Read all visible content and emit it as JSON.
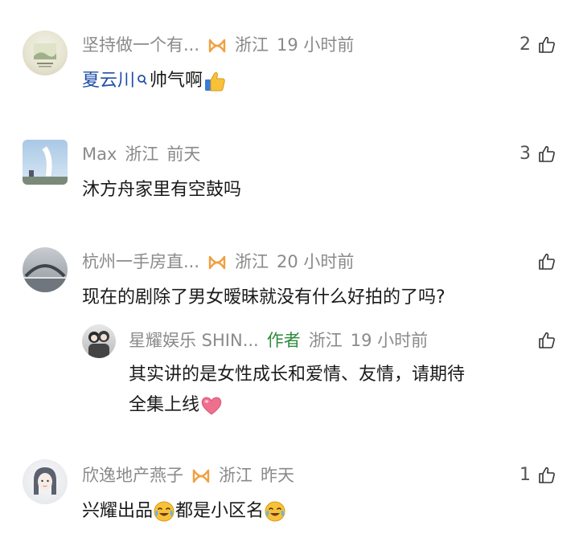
{
  "comments": [
    {
      "author": "坚持做一个有...",
      "location": "浙江",
      "time": "19 小时前",
      "likes": "2",
      "mention": "夏云川",
      "text": "帅气啊",
      "avatar_icon": "landscape-avatar",
      "emoji_icon": "thumbs-up-emoji"
    },
    {
      "author": "Max",
      "location": "浙江",
      "time": "前天",
      "likes": "3",
      "text": "沐方舟家里有空鼓吗",
      "avatar_icon": "sculpture-avatar"
    },
    {
      "author": "杭州一手房直...",
      "location": "浙江",
      "time": "20 小时前",
      "likes": "",
      "text": "现在的剧除了男女暧昧就没有什么好拍的了吗?",
      "avatar_icon": "bridge-avatar",
      "reply": {
        "author": "星耀娱乐 SHIN...",
        "tag": "作者",
        "location": "浙江",
        "time": "19 小时前",
        "likes": "",
        "text_line1": "其实讲的是女性成长和爱情、友情，请期待",
        "text_line2": "全集上线",
        "avatar_icon": "couple-avatar",
        "emoji_icon": "pink-heart-emoji"
      }
    },
    {
      "author": "欣逸地产燕子",
      "location": "浙江",
      "time": "昨天",
      "likes": "1",
      "text_part1": "兴耀出品",
      "text_part2": "都是小区名",
      "avatar_icon": "girl-avatar",
      "emoji_icon": "crying-laugh-emoji"
    }
  ],
  "colors": {
    "meta_gray": "#8a8a8a",
    "mention_blue": "#1f4fa8",
    "author_green": "#2e8b3e",
    "badge_orange": "#f0a040"
  }
}
